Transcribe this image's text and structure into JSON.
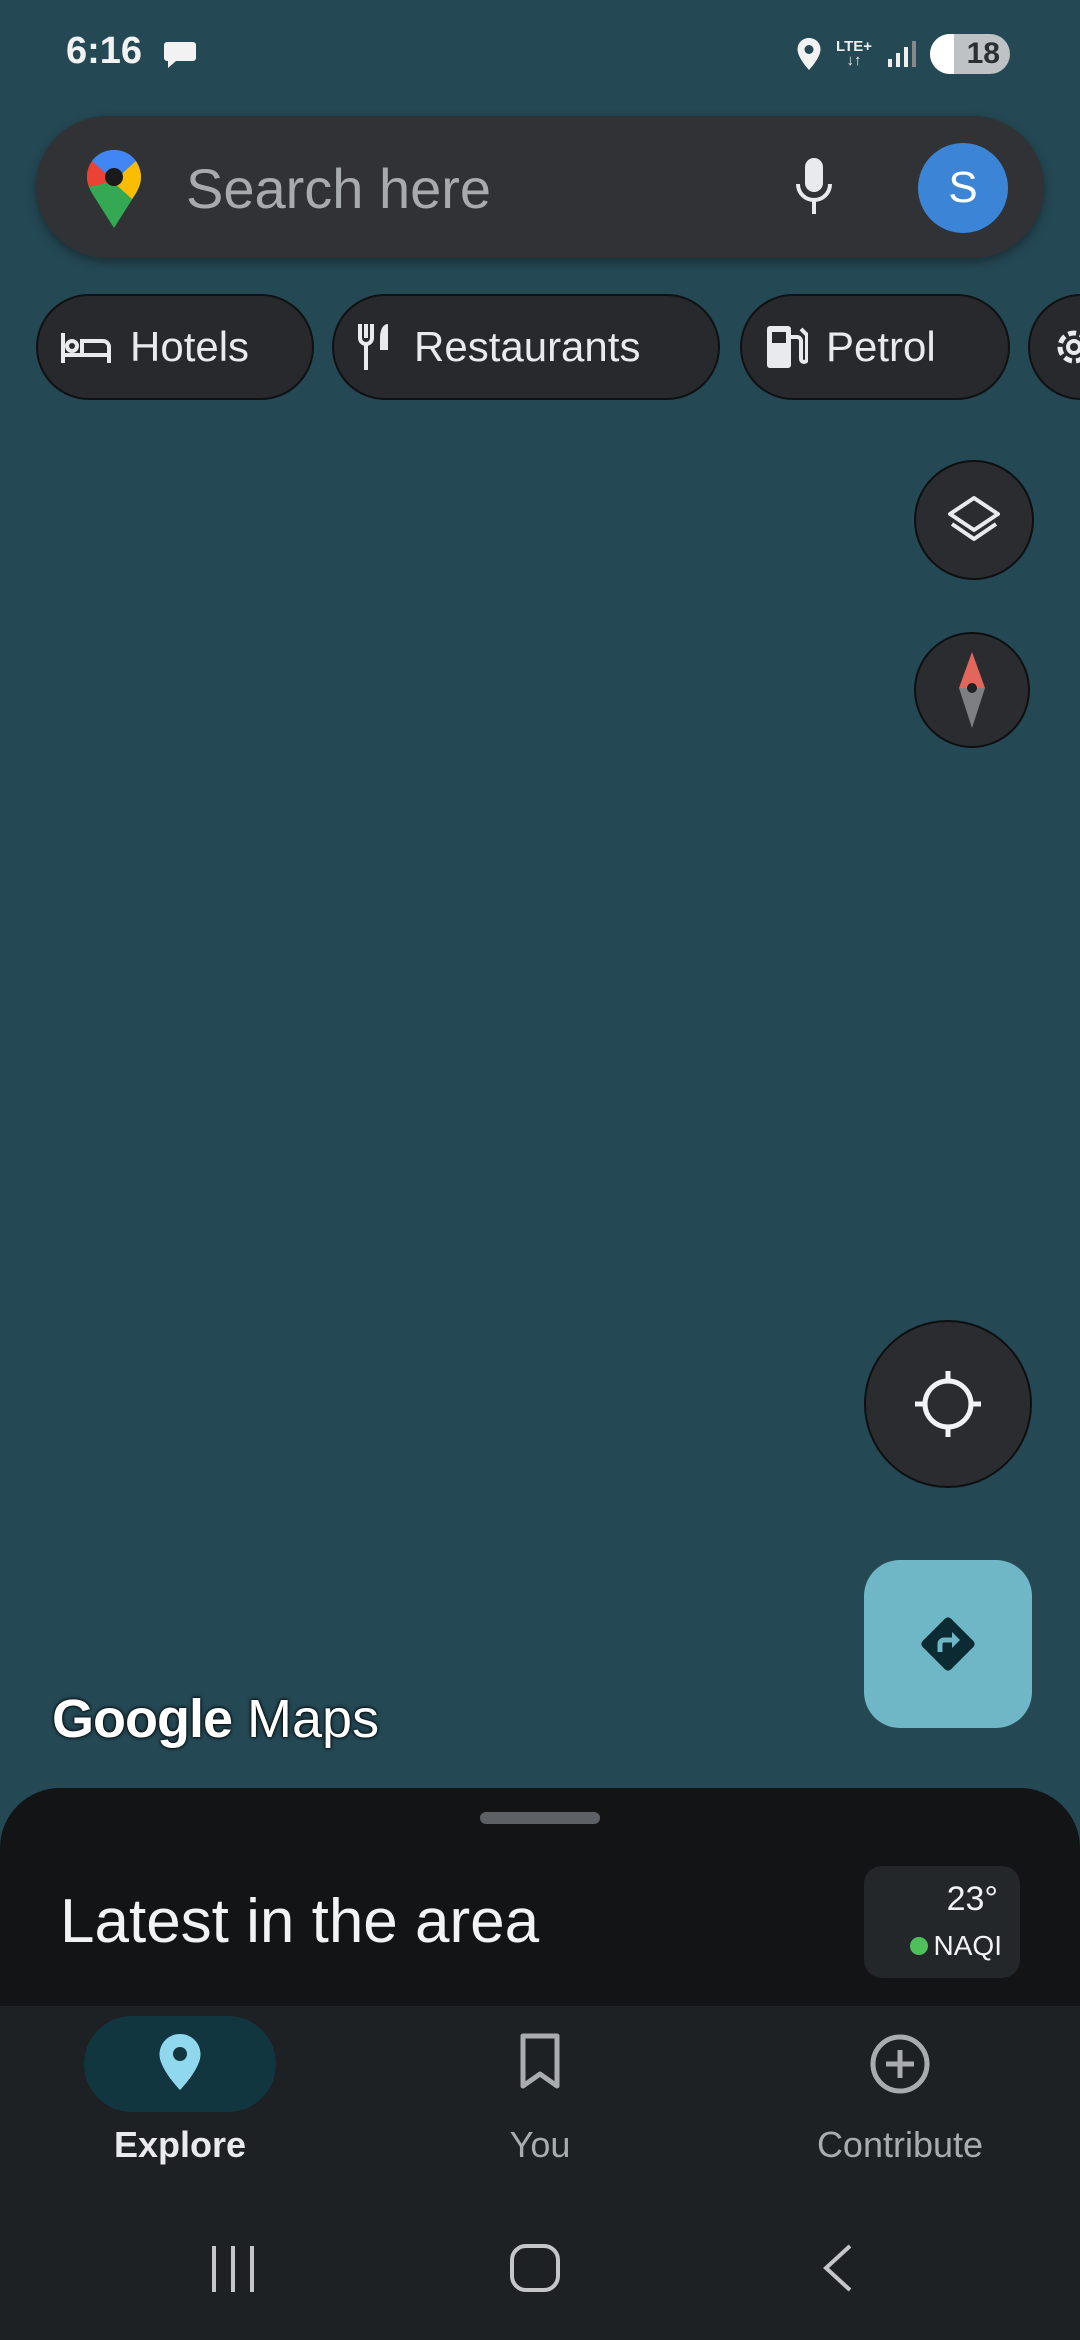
{
  "status_bar": {
    "time": "6:16",
    "network": "LTE+",
    "battery": "18"
  },
  "search": {
    "placeholder": "Search here",
    "avatar_letter": "S"
  },
  "chips": [
    {
      "label": "Hotels",
      "icon": "bed-icon"
    },
    {
      "label": "Restaurants",
      "icon": "restaurant-icon"
    },
    {
      "label": "Petrol",
      "icon": "fuel-pump-icon"
    },
    {
      "label": "",
      "icon": "settings-icon"
    }
  ],
  "map": {
    "brand_google": "Google",
    "brand_maps": "Maps",
    "background_color": "#244854"
  },
  "sheet": {
    "title": "Latest in the area",
    "weather": {
      "temperature": "23°",
      "aqi_label": "NAQI",
      "aqi_color": "#4fbf5c"
    }
  },
  "nav": {
    "items": [
      {
        "label": "Explore",
        "icon": "location-pin-icon",
        "active": true
      },
      {
        "label": "You",
        "icon": "bookmark-icon",
        "active": false
      },
      {
        "label": "Contribute",
        "icon": "add-circle-icon",
        "active": false
      }
    ]
  },
  "colors": {
    "accent": "#6fb6c6",
    "avatar": "#3b84d6"
  }
}
